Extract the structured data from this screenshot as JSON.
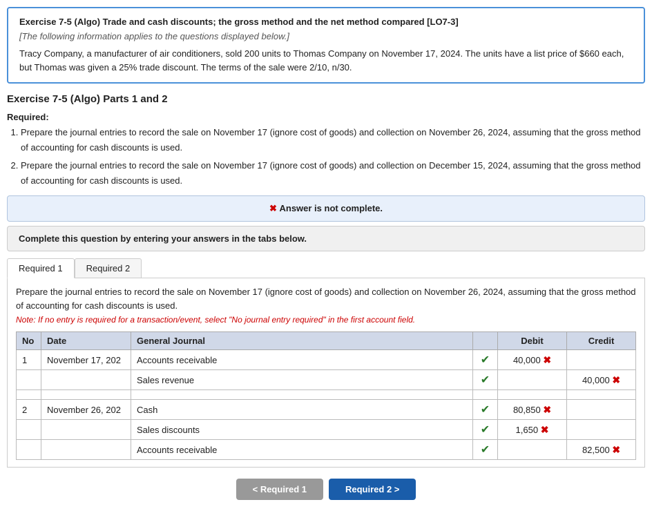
{
  "topBox": {
    "title": "Exercise 7-5 (Algo) Trade and cash discounts; the gross method and the net method compared [LO7-3]",
    "subtitle": "[The following information applies to the questions displayed below.]",
    "description": "Tracy Company, a manufacturer of air conditioners, sold 200 units to Thomas Company on November 17, 2024. The units have a list price of $660 each, but Thomas was given a 25% trade discount. The terms of the sale were 2/10, n/30."
  },
  "sectionTitle": "Exercise 7-5 (Algo) Parts 1 and 2",
  "requiredLabel": "Required:",
  "requirements": [
    "Prepare the journal entries to record the sale on November 17 (ignore cost of goods) and collection on November 26, 2024, assuming that the gross method of accounting for cash discounts is used.",
    "Prepare the journal entries to record the sale on November 17 (ignore cost of goods) and collection on December 15, 2024, assuming that the gross method of accounting for cash discounts is used."
  ],
  "answerIncomplete": {
    "icon": "✖",
    "text": "Answer is not complete."
  },
  "completeInstruction": "Complete this question by entering your answers in the tabs below.",
  "tabs": [
    {
      "label": "Required 1",
      "active": true
    },
    {
      "label": "Required 2",
      "active": false
    }
  ],
  "tabContent": {
    "description": "Prepare the journal entries to record the sale on November 17 (ignore cost of goods) and collection on November 26, 2024, assuming that the gross method of accounting for cash discounts is used.",
    "note": "Note: If no entry is required for a transaction/event, select \"No journal entry required\" in the first account field.",
    "tableHeaders": {
      "no": "No",
      "date": "Date",
      "generalJournal": "General Journal",
      "check": "",
      "debit": "Debit",
      "credit": "Credit"
    },
    "rows": [
      {
        "no": "1",
        "date": "November 17, 202",
        "account": "Accounts receivable",
        "debit": "40,000",
        "credit": "",
        "debitError": true,
        "creditError": false,
        "indent": false
      },
      {
        "no": "",
        "date": "",
        "account": "Sales revenue",
        "debit": "",
        "credit": "40,000",
        "debitError": false,
        "creditError": true,
        "indent": true
      },
      {
        "no": "",
        "date": "",
        "account": "",
        "debit": "",
        "credit": "",
        "debitError": false,
        "creditError": false,
        "indent": false,
        "spacer": true
      },
      {
        "no": "2",
        "date": "November 26, 202",
        "account": "Cash",
        "debit": "80,850",
        "credit": "",
        "debitError": true,
        "creditError": false,
        "indent": false
      },
      {
        "no": "",
        "date": "",
        "account": "Sales discounts",
        "debit": "1,650",
        "credit": "",
        "debitError": true,
        "creditError": false,
        "indent": true
      },
      {
        "no": "",
        "date": "",
        "account": "Accounts receivable",
        "debit": "",
        "credit": "82,500",
        "debitError": false,
        "creditError": true,
        "indent": true
      }
    ]
  },
  "bottomNav": {
    "prevLabel": "< Required 1",
    "nextLabel": "Required 2 >"
  }
}
